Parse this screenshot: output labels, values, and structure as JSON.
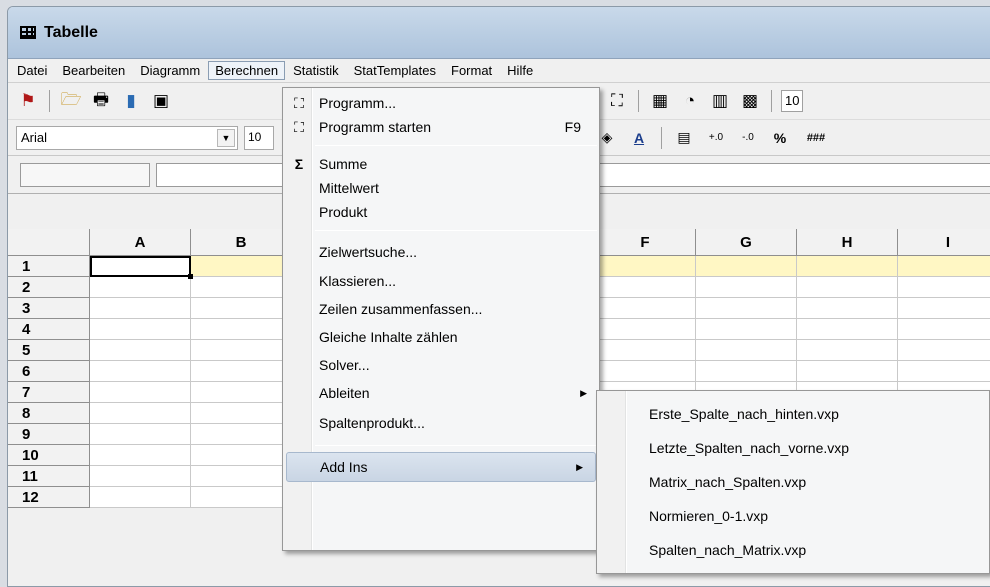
{
  "window": {
    "title": "Tabelle"
  },
  "menubar": {
    "items": [
      "Datei",
      "Bearbeiten",
      "Diagramm",
      "Berechnen",
      "Statistik",
      "StatTemplates",
      "Format",
      "Hilfe"
    ],
    "active_index": 3
  },
  "toolbar": {
    "icons_left": [
      "flag-icon",
      "open-folder-icon",
      "print-icon",
      "add-chart-icon",
      "camera-icon"
    ],
    "icons_right": [
      "fx-table-icon",
      "sigma-icon",
      "program-icon",
      "program-run-icon",
      "calculator-icon",
      "curve-icon",
      "regression-chart-icon",
      "histogram-icon"
    ],
    "partial_value": "10",
    "sigma_glyph": "Σ"
  },
  "formatbar": {
    "font_name": "Arial",
    "font_size": "10",
    "percent_label": "%",
    "hash_label": "###"
  },
  "grid": {
    "columns": [
      "A",
      "B",
      "C",
      "D",
      "E",
      "F",
      "G",
      "H",
      "I"
    ],
    "rows": [
      "1",
      "2",
      "3",
      "4",
      "5",
      "6",
      "7",
      "8",
      "9",
      "10",
      "11",
      "12"
    ],
    "active_cell": "A1",
    "highlight_row_color": "#fff7c4"
  },
  "berechnen_menu": {
    "program": "Programm...",
    "program_start": "Programm starten",
    "program_start_shortcut": "F9",
    "sum_icon": "Σ",
    "sum": "Summe",
    "mean": "Mittelwert",
    "product": "Produkt",
    "goal_seek": "Zielwertsuche...",
    "classify": "Klassieren...",
    "merge_rows": "Zeilen zusammenfassen...",
    "count_equal": "Gleiche Inhalte zählen",
    "solver": "Solver...",
    "derive": "Ableiten",
    "col_product": "Spaltenprodukt...",
    "add_ins": "Add Ins"
  },
  "add_ins_submenu": {
    "items": [
      "Erste_Spalte_nach_hinten.vxp",
      "Letzte_Spalten_nach_vorne.vxp",
      "Matrix_nach_Spalten.vxp",
      "Normieren_0-1.vxp",
      "Spalten_nach_Matrix.vxp"
    ]
  }
}
